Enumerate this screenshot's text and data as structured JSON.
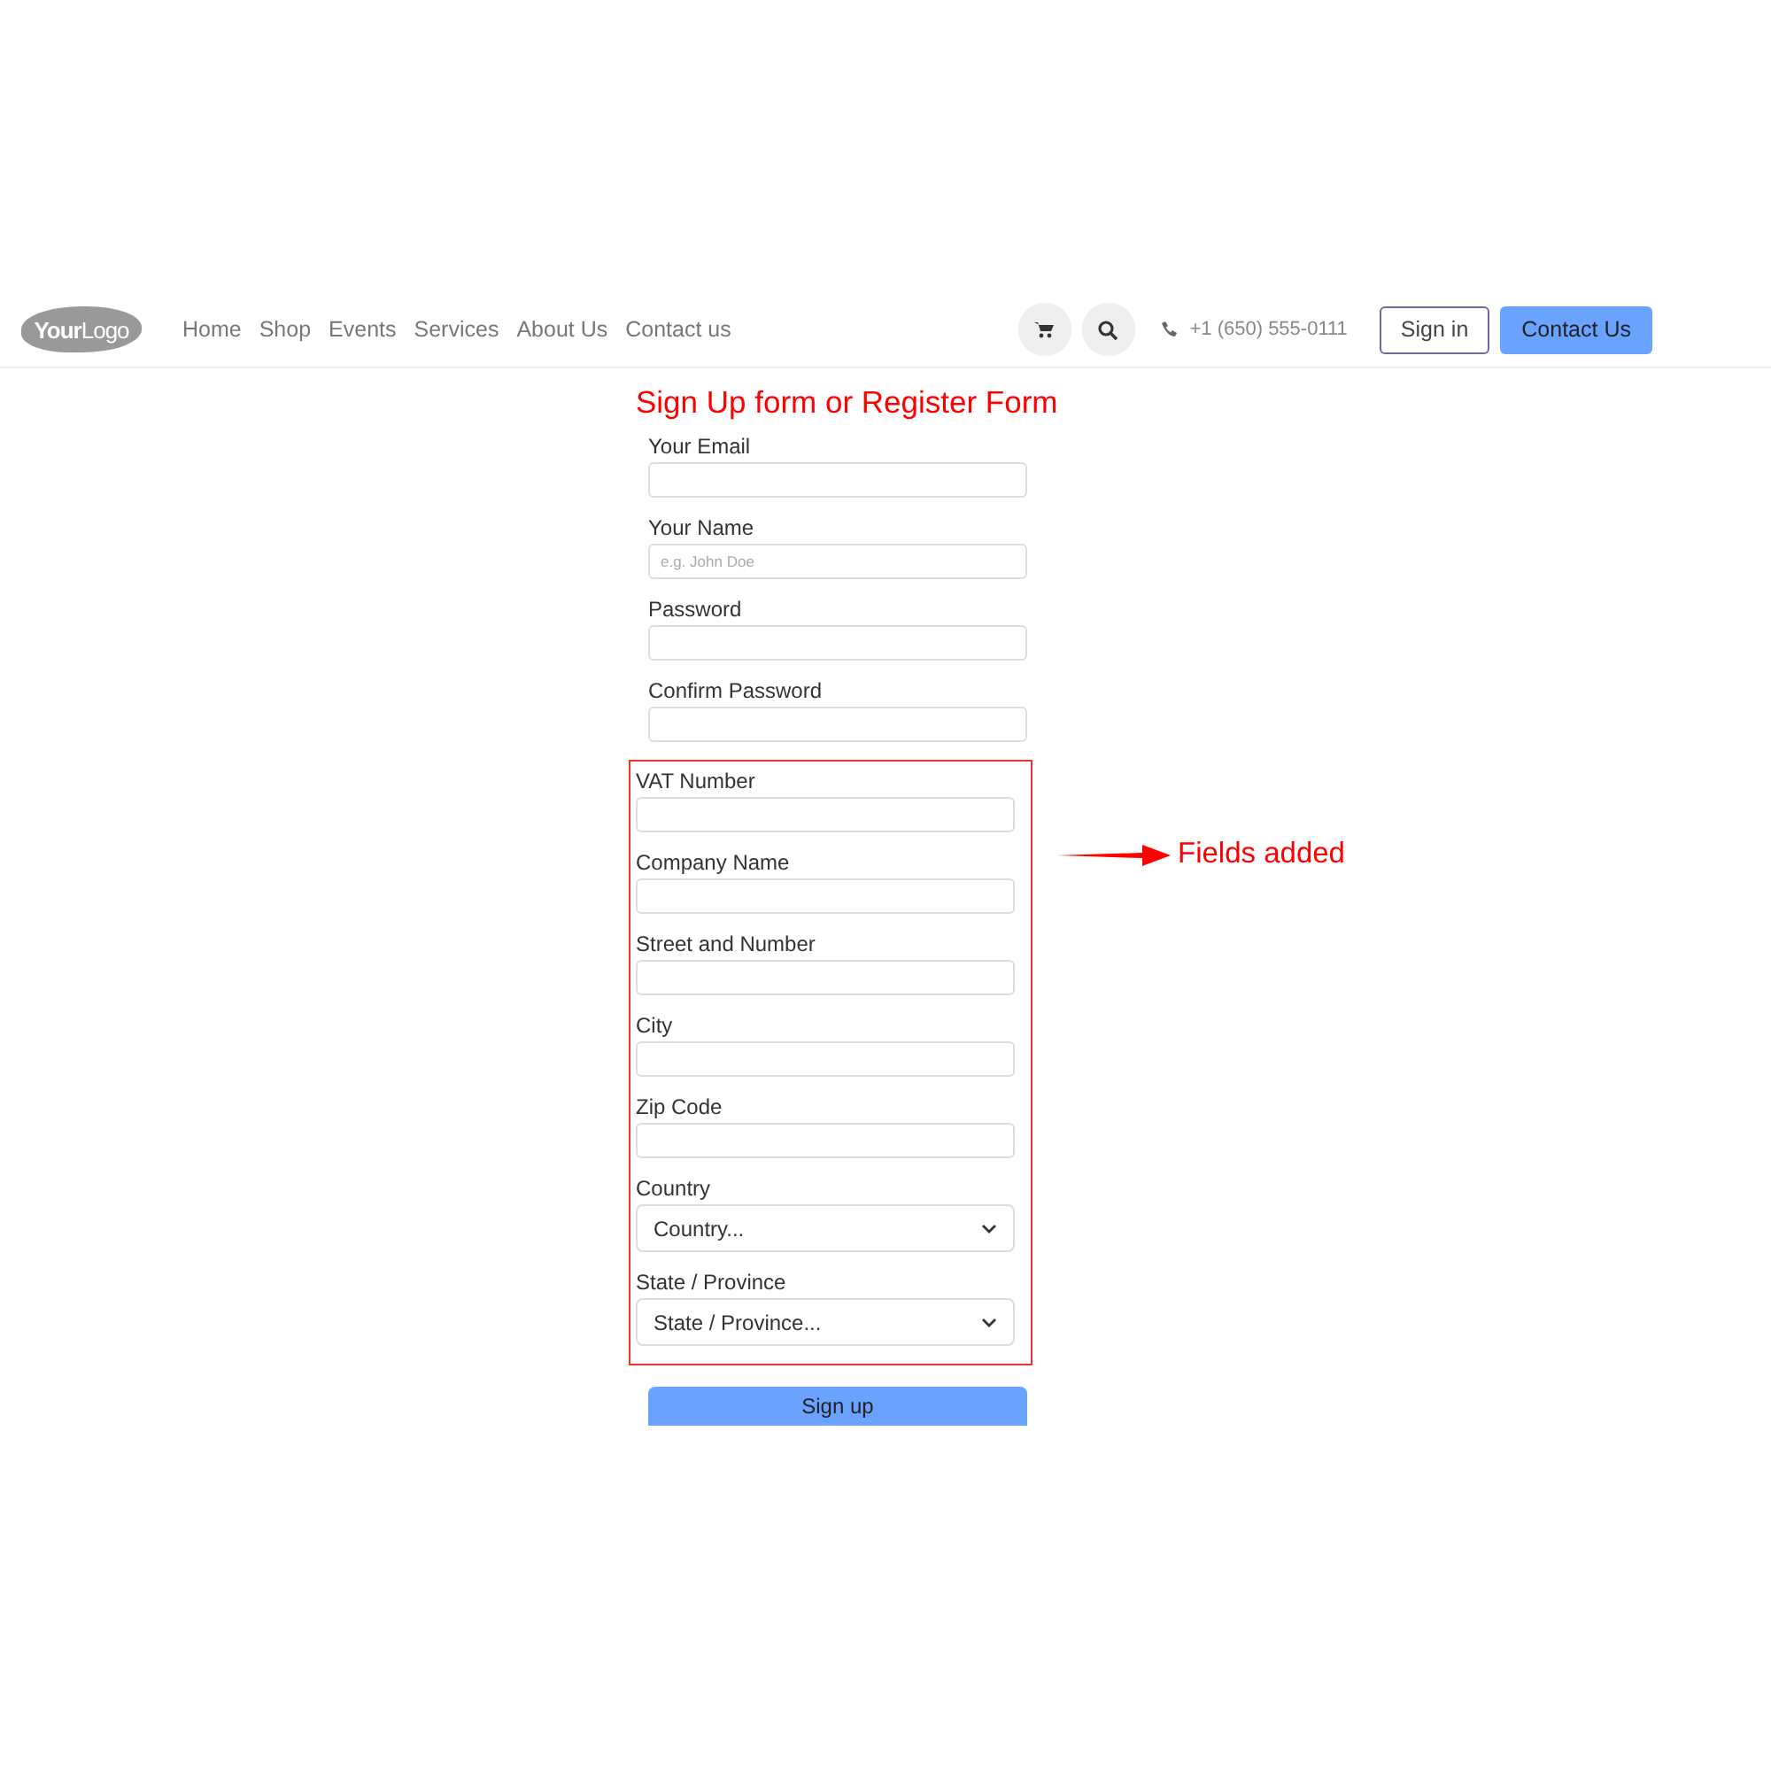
{
  "header": {
    "logo": "**Your**Logo",
    "nav": [
      {
        "label": "Home"
      },
      {
        "label": "Shop"
      },
      {
        "label": "Events"
      },
      {
        "label": "Services"
      },
      {
        "label": "About Us"
      },
      {
        "label": "Contact us"
      }
    ],
    "phone": "+1 (650) 555-0111",
    "sign_in": "Sign in",
    "contact_button": "Contact Us"
  },
  "title": "Sign Up form or Register Form",
  "fields": [
    {
      "kind": "text",
      "label": "Your Email"
    },
    {
      "kind": "text",
      "label": "Your Name",
      "placeholder": "e.g. John Doe"
    },
    {
      "kind": "text",
      "label": "Password"
    },
    {
      "kind": "text",
      "label": "Confirm Password"
    }
  ],
  "added_fields": [
    {
      "kind": "text",
      "label": "VAT Number"
    },
    {
      "kind": "text",
      "label": "Company Name"
    },
    {
      "kind": "text",
      "label": "Street and Number"
    },
    {
      "kind": "text",
      "label": "City"
    },
    {
      "kind": "text",
      "label": "Zip Code"
    },
    {
      "kind": "select",
      "label": "Country",
      "value": "Country..."
    },
    {
      "kind": "select",
      "label": "State / Province",
      "value": "State / Province..."
    }
  ],
  "annotation": "Fields added",
  "submit": "Sign up"
}
